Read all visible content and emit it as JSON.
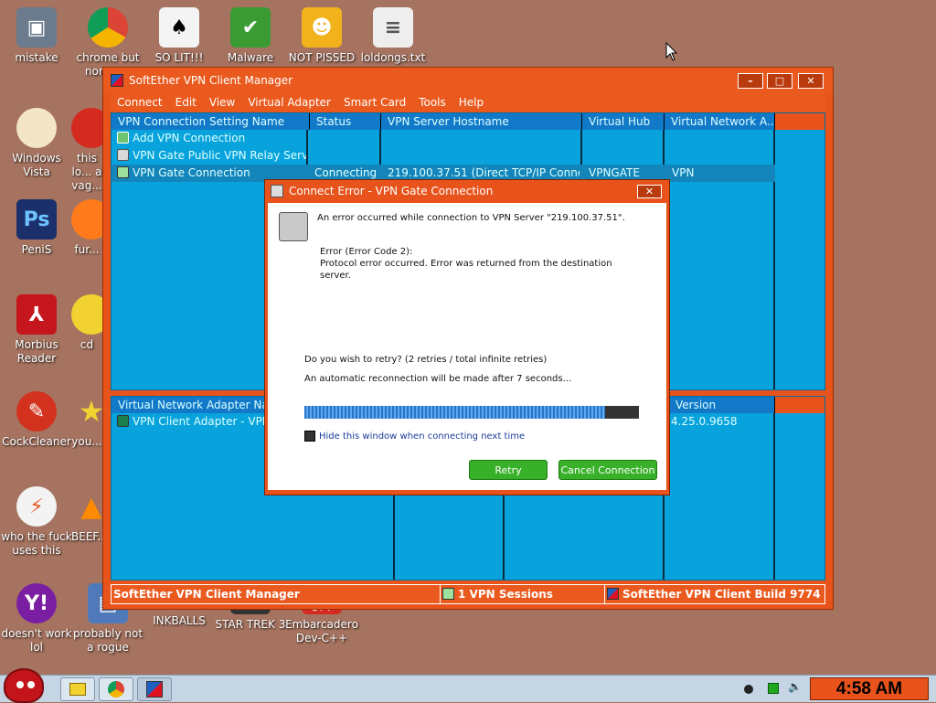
{
  "desktop": {
    "icons": [
      {
        "label": "mistake",
        "icon": "computer-icon"
      },
      {
        "label": "chrome but norma...",
        "icon": "chrome-icon"
      },
      {
        "label": "SO LIT!!! AIRE",
        "icon": "cards-icon"
      },
      {
        "label": "Malware",
        "icon": "shield-icon"
      },
      {
        "label": "NOT PISSED",
        "icon": "pig-icon"
      },
      {
        "label": "loldongs.txt",
        "icon": "document-icon"
      },
      {
        "label": "Windows Vista",
        "icon": "egg-icon"
      },
      {
        "label": "this lo... a vag...",
        "icon": "red-ball-icon"
      },
      {
        "label": "PeniS",
        "icon": "photoshop-icon"
      },
      {
        "label": "fur...",
        "icon": "firefox-icon"
      },
      {
        "label": "Morbius Reader",
        "icon": "pdf-icon"
      },
      {
        "label": "cd",
        "icon": "disc-icon"
      },
      {
        "label": "CockCleaner",
        "icon": "broom-icon"
      },
      {
        "label": "you...",
        "icon": "star-icon"
      },
      {
        "label": "who the fuck uses this",
        "icon": "lightning-icon"
      },
      {
        "label": "BEEF...",
        "icon": "cone-icon"
      },
      {
        "label": "doesn't work lol",
        "icon": "yahoo-icon"
      },
      {
        "label": "probably not a rogue",
        "icon": "network-icon"
      },
      {
        "label": "INKBALLS",
        "icon": "ball-icon"
      },
      {
        "label": "STAR TREK 3",
        "icon": "starwars-icon"
      },
      {
        "label": "Embarcadero Dev-C++",
        "icon": "cpp-icon"
      }
    ]
  },
  "window": {
    "title": "SoftEther VPN Client Manager",
    "buttons": {
      "minimize": "–",
      "maximize": "□",
      "close": "✕"
    },
    "menu": [
      "Connect",
      "Edit",
      "View",
      "Virtual Adapter",
      "Smart Card",
      "Tools",
      "Help"
    ],
    "connections": {
      "columns": [
        "VPN Connection Setting Name",
        "Status",
        "VPN Server Hostname",
        "Virtual Hub",
        "Virtual Network A..."
      ],
      "rows": [
        {
          "name": "Add VPN Connection",
          "status": "",
          "host": "",
          "hub": "",
          "adapter": ""
        },
        {
          "name": "VPN Gate Public VPN Relay Servers",
          "status": "",
          "host": "",
          "hub": "",
          "adapter": ""
        },
        {
          "name": "VPN Gate Connection",
          "status": "Connecting",
          "host": "219.100.37.51 (Direct TCP/IP Conne...",
          "hub": "VPNGATE",
          "adapter": "VPN"
        }
      ]
    },
    "adapters": {
      "columns": [
        "Virtual Network Adapter Name",
        "Version"
      ],
      "rows": [
        {
          "name": "VPN Client Adapter - VPN",
          "version": "4.25.0.9658"
        }
      ]
    },
    "status_bar": {
      "app": "SoftEther VPN Client Manager",
      "sessions": "1 VPN Sessions",
      "build": "SoftEther VPN Client Build 9774"
    }
  },
  "dialog": {
    "title": "Connect Error - VPN Gate Connection",
    "close": "✕",
    "message": "An error occurred while connection to VPN Server \"219.100.37.51\".",
    "error_code": "Error (Error Code 2):",
    "error_detail_1": "Protocol error occurred. Error was returned from the destination",
    "error_detail_2": "server.",
    "retry_question": "Do you wish to retry? (2 retries / total infinite retries)",
    "auto_reconnect": "An automatic reconnection will be made after 7 seconds...",
    "progress": 0.9,
    "hide_checkbox_label": "Hide this window when connecting next time",
    "retry_button": "Retry",
    "cancel_button": "Cancel Connection"
  },
  "taskbar": {
    "clock": "4:58 AM"
  },
  "colors": {
    "accent": "#e8531c",
    "pane": "#08a3dc",
    "desktop": "#a5735f"
  }
}
